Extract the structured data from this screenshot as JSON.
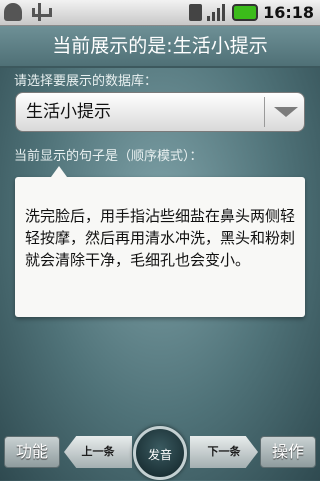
{
  "status_bar": {
    "left_icons": [
      "android-icon",
      "usb-icon"
    ],
    "right_icons": [
      "sim-icon",
      "signal-icon",
      "battery-icon"
    ],
    "time": "16:18",
    "battery_color": "#3bbb1a"
  },
  "title_bar": {
    "title": "当前展示的是:生活小提示"
  },
  "database_prompt": "请选择要展示的数据库：",
  "database_spinner": {
    "value": "生活小提示"
  },
  "sentence_label": "当前显示的句子是（顺序模式）：",
  "sentence": {
    "text": "洗完脸后，用手指沾些细盐在鼻头两侧轻轻按摩，然后再用清水冲洗，黑头和粉刺就会清除干净，毛细孔也会变小。"
  },
  "bottom_bar": {
    "function_label": "功能",
    "prev_label": "上一条",
    "sound_label": "发音",
    "next_label": "下一条",
    "operation_label": "操作"
  },
  "colors": {
    "background": "#4f7278",
    "title_bar": "#5f8086"
  }
}
